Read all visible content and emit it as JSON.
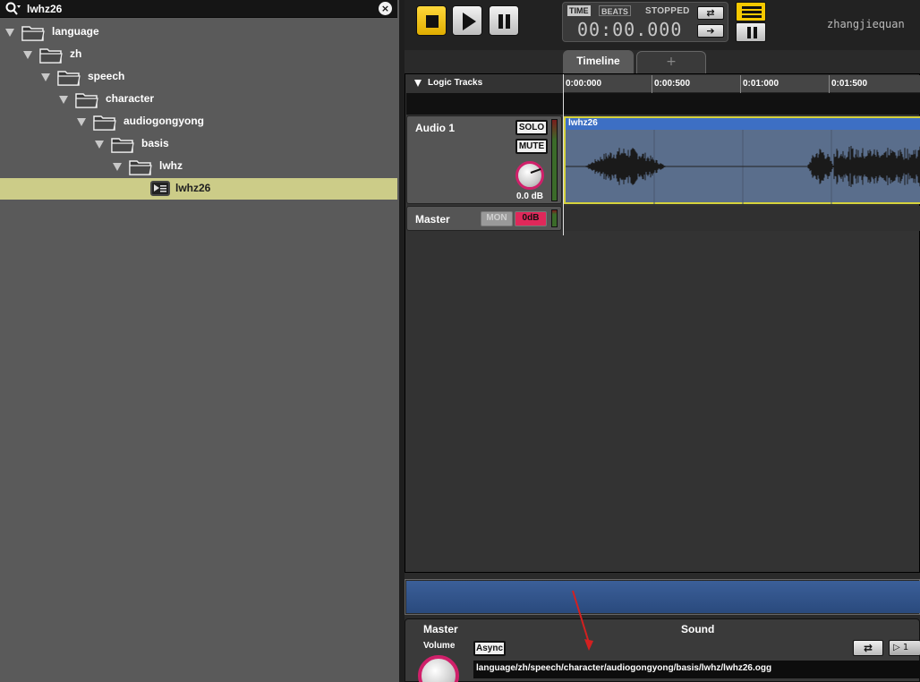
{
  "search": {
    "value": "lwhz26",
    "clear_label": "×"
  },
  "tree": [
    {
      "label": "language",
      "type": "folder",
      "depth": 0
    },
    {
      "label": "zh",
      "type": "folder",
      "depth": 1
    },
    {
      "label": "speech",
      "type": "folder",
      "depth": 2
    },
    {
      "label": "character",
      "type": "folder",
      "depth": 3
    },
    {
      "label": "audiogongyong",
      "type": "folder",
      "depth": 4
    },
    {
      "label": "basis",
      "type": "folder",
      "depth": 5
    },
    {
      "label": "lwhz",
      "type": "folder",
      "depth": 6
    },
    {
      "label": "lwhz26",
      "type": "event",
      "depth": 7,
      "selected": true
    }
  ],
  "transport": {
    "time_tab": "TIME",
    "beats_tab": "BEATS",
    "status": "STOPPED",
    "time": "00:00.000",
    "loop_icon": "⇄",
    "follow_icon": "➔"
  },
  "user": {
    "name": "zhangjiequan"
  },
  "tabs": {
    "active": "Timeline",
    "add": "+"
  },
  "tracks_header": {
    "label": "Logic Tracks"
  },
  "ruler": {
    "ticks": [
      "0:00:000",
      "0:00:500",
      "0:01:000",
      "0:01:500"
    ]
  },
  "audio_track": {
    "name": "Audio 1",
    "solo": "SOLO",
    "mute": "MUTE",
    "volume": "0.0 dB",
    "clip_name": "lwhz26"
  },
  "master_track": {
    "name": "Master",
    "mon": "MON",
    "odb": "0dB"
  },
  "bottom": {
    "master_title": "Master",
    "sound_title": "Sound",
    "volume_label": "Volume",
    "async": "Async",
    "loop_icon": "⇄",
    "count": "1",
    "path": "language/zh/speech/character/audiogongyong/basis/lwhz/lwhz26.ogg"
  },
  "colors": {
    "accent_yellow": "#f5c800",
    "selection": "#cccc88",
    "clip_header": "#3d6fc4",
    "clip_body": "#5a6e8c",
    "knob_ring": "#d0206a",
    "annotation_arrow": "#d42020"
  }
}
